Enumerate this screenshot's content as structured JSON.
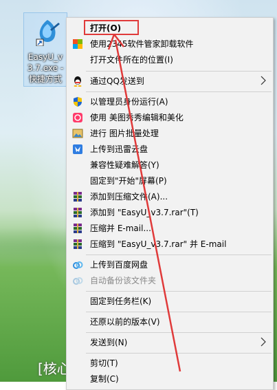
{
  "desktop": {
    "icon_label": "EasyU_v3.7.exe - 快捷方式",
    "bottom_text": "[核心"
  },
  "menu": {
    "items": [
      {
        "label": "打开(O)",
        "icon": "none"
      },
      {
        "label": "使用2345软件管家卸载软件",
        "icon": "2345-icon"
      },
      {
        "label": "打开文件所在的位置(I)",
        "icon": "none"
      },
      {
        "label": "通过QQ发送到",
        "icon": "qq-icon"
      },
      {
        "label": "以管理员身份运行(A)",
        "icon": "shield-icon"
      },
      {
        "label": "使用 美图秀秀编辑和美化",
        "icon": "meitu-icon"
      },
      {
        "label": "进行 图片批量处理",
        "icon": "image-batch-icon"
      },
      {
        "label": "上传到迅雷云盘",
        "icon": "thunder-icon"
      },
      {
        "label": "兼容性疑难解答(Y)",
        "icon": "none"
      },
      {
        "label": "固定到\"开始\"屏幕(P)",
        "icon": "none"
      },
      {
        "label": "添加到压缩文件(A)...",
        "icon": "winrar-icon"
      },
      {
        "label": "添加到 \"EasyU_v3.7.rar\"(T)",
        "icon": "winrar-icon"
      },
      {
        "label": "压缩并 E-mail...",
        "icon": "winrar-icon"
      },
      {
        "label": "压缩到 \"EasyU_v3.7.rar\" 并 E-mail",
        "icon": "winrar-icon"
      },
      {
        "label": "上传到百度网盘",
        "icon": "baidu-cloud-icon"
      },
      {
        "label": "自动备份该文件夹",
        "icon": "baidu-cloud-icon"
      },
      {
        "label": "固定到任务栏(K)",
        "icon": "none"
      },
      {
        "label": "还原以前的版本(V)",
        "icon": "none"
      },
      {
        "label": "发送到(N)",
        "icon": "none"
      },
      {
        "label": "剪切(T)",
        "icon": "none"
      },
      {
        "label": "复制(C)",
        "icon": "none"
      }
    ]
  },
  "colors": {
    "menu_bg": "#f2f2f2",
    "highlight_box": "#e03a3a",
    "arrow": "#e03a3a"
  }
}
